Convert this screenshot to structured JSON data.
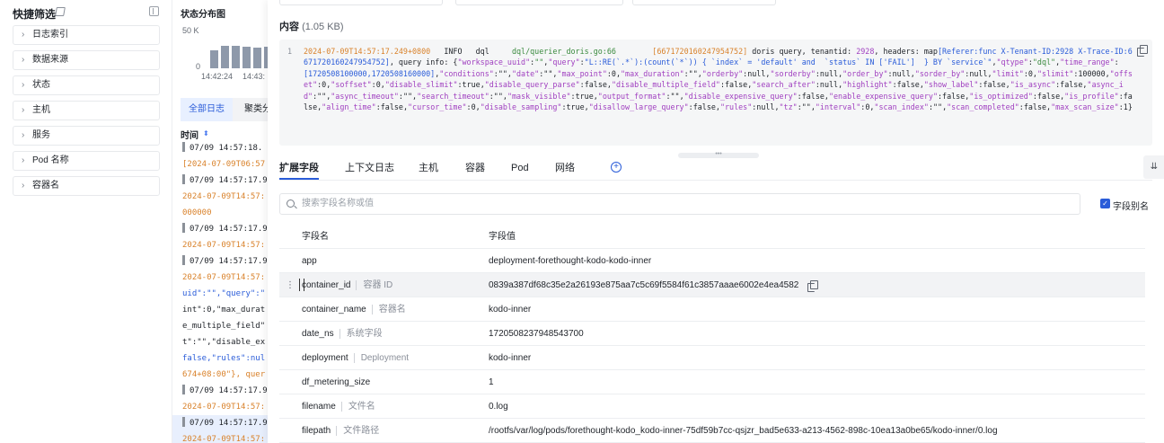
{
  "sidebar": {
    "title": "快捷筛选",
    "items": [
      "日志索引",
      "数据来源",
      "状态",
      "主机",
      "服务",
      "Pod 名称",
      "容器名"
    ]
  },
  "status_chart": {
    "title": "状态分布图",
    "y_max_label": "50 K",
    "y_min_label": "0",
    "x_labels": [
      "14:42:24",
      "14:43:"
    ]
  },
  "chart_data": {
    "type": "bar",
    "title": "状态分布图",
    "ylim": [
      0,
      50000
    ],
    "yticks": [
      "0",
      "50 K"
    ],
    "x_tick_labels": [
      "14:42:24",
      "14:43:"
    ],
    "values": [
      24000,
      30000,
      30000,
      29000,
      27000,
      28000
    ]
  },
  "mid_tabs": [
    "全部日志",
    "聚类分"
  ],
  "time_header": "时间",
  "log_rows": [
    {
      "t": "07/09 14:57:18.",
      "c": "ts"
    },
    {
      "t": "[2024-07-09T06:57",
      "c": "or"
    },
    {
      "t": "07/09 14:57:17.9",
      "c": "ts"
    },
    {
      "t": "2024-07-09T14:57:",
      "c": "or"
    },
    {
      "t": "000000",
      "c": "or"
    },
    {
      "t": "07/09 14:57:17.9",
      "c": "ts"
    },
    {
      "t": "2024-07-09T14:57:",
      "c": "or"
    },
    {
      "t": "07/09 14:57:17.9",
      "c": "ts"
    },
    {
      "t": "2024-07-09T14:57:",
      "c": "or"
    },
    {
      "t": "uid\":\"\",\"query\":\"",
      "c": "bl"
    },
    {
      "t": "int\":0,\"max_durat",
      "c": "ts2"
    },
    {
      "t": "e_multiple_field\"",
      "c": "ts2"
    },
    {
      "t": "t\":\"\",\"disable_ex",
      "c": "ts2"
    },
    {
      "t": "false,\"rules\":nul",
      "c": "bl"
    },
    {
      "t": "674+08:00\"}, quer",
      "c": "or"
    },
    {
      "t": "07/09 14:57:17.9",
      "c": "ts"
    },
    {
      "t": "2024-07-09T14:57:",
      "c": "or"
    },
    {
      "t": "07/09 14:57:17.9",
      "c": "ts hl"
    },
    {
      "t": "2024-07-09T14:57:",
      "c": "or hl"
    }
  ],
  "content": {
    "title": "内容",
    "size": "(1.05 KB)",
    "line_no": "1",
    "segments": [
      {
        "t": "2024-07-09T14:57:17.249+0800",
        "c": "c-or"
      },
      {
        "t": "   INFO   dql     ",
        "c": ""
      },
      {
        "t": "dql/querier_doris.go:66",
        "c": "c-gr"
      },
      {
        "t": "        ",
        "c": ""
      },
      {
        "t": "[6671720160247954752]",
        "c": "c-or"
      },
      {
        "t": " doris query, tenantid: ",
        "c": ""
      },
      {
        "t": "2928",
        "c": "c-pu"
      },
      {
        "t": ", headers: map",
        "c": ""
      },
      {
        "t": "[Referer:func X-Tenant-ID:2928 X-Trace-ID:6671720160247954752]",
        "c": "c-bl"
      },
      {
        "t": ", query info: {",
        "c": ""
      },
      {
        "t": "\"workspace_uuid\"",
        "c": "c-pu"
      },
      {
        "t": ":",
        "c": ""
      },
      {
        "t": "\"\"",
        "c": "c-gr"
      },
      {
        "t": ",",
        "c": ""
      },
      {
        "t": "\"query\"",
        "c": "c-pu"
      },
      {
        "t": ":",
        "c": ""
      },
      {
        "t": "\"L::RE(`.*`):(count(`*`)) { `index` = 'default' and  `status` IN ['FAIL']  } BY `service`\"",
        "c": "c-bl"
      },
      {
        "t": ",",
        "c": ""
      },
      {
        "t": "\"qtype\"",
        "c": "c-pu"
      },
      {
        "t": ":",
        "c": ""
      },
      {
        "t": "\"dql\"",
        "c": "c-gr"
      },
      {
        "t": ",",
        "c": ""
      },
      {
        "t": "\"time_range\"",
        "c": "c-pu"
      },
      {
        "t": ":\n",
        "c": ""
      },
      {
        "t": "[1720508100000,1720508160000]",
        "c": "c-bl"
      },
      {
        "t": ",",
        "c": ""
      },
      {
        "t": "\"conditions\"",
        "c": "c-pu"
      },
      {
        "t": ":\"\",",
        "c": ""
      },
      {
        "t": "\"date\"",
        "c": "c-pu"
      },
      {
        "t": ":\"\",",
        "c": ""
      },
      {
        "t": "\"max_point\"",
        "c": "c-pu"
      },
      {
        "t": ":0,",
        "c": ""
      },
      {
        "t": "\"max_duration\"",
        "c": "c-pu"
      },
      {
        "t": ":\"\",",
        "c": ""
      },
      {
        "t": "\"orderby\"",
        "c": "c-pu"
      },
      {
        "t": ":null,",
        "c": ""
      },
      {
        "t": "\"sorderby\"",
        "c": "c-pu"
      },
      {
        "t": ":null,",
        "c": ""
      },
      {
        "t": "\"order_by\"",
        "c": "c-pu"
      },
      {
        "t": ":null,",
        "c": ""
      },
      {
        "t": "\"sorder_by\"",
        "c": "c-pu"
      },
      {
        "t": ":null,",
        "c": ""
      },
      {
        "t": "\"limit\"",
        "c": "c-pu"
      },
      {
        "t": ":0,",
        "c": ""
      },
      {
        "t": "\"slimit\"",
        "c": "c-pu"
      },
      {
        "t": ":100000,",
        "c": ""
      },
      {
        "t": "\"offset\"",
        "c": "c-pu"
      },
      {
        "t": ":0,",
        "c": ""
      },
      {
        "t": "\"soffset\"",
        "c": "c-pu"
      },
      {
        "t": ":0,",
        "c": ""
      },
      {
        "t": "\"disable_slimit\"",
        "c": "c-pu"
      },
      {
        "t": ":true,",
        "c": ""
      },
      {
        "t": "\"disable_query_parse\"",
        "c": "c-pu"
      },
      {
        "t": ":false,",
        "c": ""
      },
      {
        "t": "\"disable_multiple_field\"",
        "c": "c-pu"
      },
      {
        "t": ":false,",
        "c": ""
      },
      {
        "t": "\"search_after\"",
        "c": "c-pu"
      },
      {
        "t": ":null,",
        "c": ""
      },
      {
        "t": "\"highlight\"",
        "c": "c-pu"
      },
      {
        "t": ":false,",
        "c": ""
      },
      {
        "t": "\"show_label\"",
        "c": "c-pu"
      },
      {
        "t": ":false,",
        "c": ""
      },
      {
        "t": "\"is_async\"",
        "c": "c-pu"
      },
      {
        "t": ":false,",
        "c": ""
      },
      {
        "t": "\"async_id\"",
        "c": "c-pu"
      },
      {
        "t": ":\"\",",
        "c": ""
      },
      {
        "t": "\"async_timeout\"",
        "c": "c-pu"
      },
      {
        "t": ":\"\",",
        "c": ""
      },
      {
        "t": "\"search_timeout\"",
        "c": "c-pu"
      },
      {
        "t": ":\"\",",
        "c": ""
      },
      {
        "t": "\"mask_visible\"",
        "c": "c-pu"
      },
      {
        "t": ":true,",
        "c": ""
      },
      {
        "t": "\"output_format\"",
        "c": "c-pu"
      },
      {
        "t": ":\"\",",
        "c": ""
      },
      {
        "t": "\"disable_expensive_query\"",
        "c": "c-pu"
      },
      {
        "t": ":false,",
        "c": ""
      },
      {
        "t": "\"enable_expensive_query\"",
        "c": "c-pu"
      },
      {
        "t": ":false,",
        "c": ""
      },
      {
        "t": "\"is_optimized\"",
        "c": "c-pu"
      },
      {
        "t": ":false,",
        "c": ""
      },
      {
        "t": "\"is_profile\"",
        "c": "c-pu"
      },
      {
        "t": ":false,",
        "c": ""
      },
      {
        "t": "\"align_time\"",
        "c": "c-pu"
      },
      {
        "t": ":false,",
        "c": ""
      },
      {
        "t": "\"cursor_time\"",
        "c": "c-pu"
      },
      {
        "t": ":0,",
        "c": ""
      },
      {
        "t": "\"disable_sampling\"",
        "c": "c-pu"
      },
      {
        "t": ":true,",
        "c": ""
      },
      {
        "t": "\"disallow_large_query\"",
        "c": "c-pu"
      },
      {
        "t": ":false,",
        "c": ""
      },
      {
        "t": "\"rules\"",
        "c": "c-pu"
      },
      {
        "t": ":null,",
        "c": ""
      },
      {
        "t": "\"tz\"",
        "c": "c-pu"
      },
      {
        "t": ":\"\",",
        "c": ""
      },
      {
        "t": "\"interval\"",
        "c": "c-pu"
      },
      {
        "t": ":0,",
        "c": ""
      },
      {
        "t": "\"scan_index\"",
        "c": "c-pu"
      },
      {
        "t": ":\"\",",
        "c": ""
      },
      {
        "t": "\"scan_completed\"",
        "c": "c-pu"
      },
      {
        "t": ":false,",
        "c": ""
      },
      {
        "t": "\"max_scan_size\"",
        "c": "c-pu"
      },
      {
        "t": ":1}",
        "c": ""
      }
    ]
  },
  "detail_tabs": [
    "扩展字段",
    "上下文日志",
    "主机",
    "容器",
    "Pod",
    "网络"
  ],
  "field_search": {
    "placeholder": "搜索字段名称或值"
  },
  "alias_toggle": {
    "label": "字段别名",
    "checked": true
  },
  "table": {
    "headers": [
      "字段名",
      "字段值"
    ],
    "rows": [
      {
        "name": "app",
        "alias": "",
        "value": "deployment-forethought-kodo-kodo-inner"
      },
      {
        "name": "container_id",
        "alias": "容器 ID",
        "value": "0839a387df68c35e2a26193e875aa7c5c69f5584f61c3857aaae6002e4ea4582"
      },
      {
        "name": "container_name",
        "alias": "容器名",
        "value": "kodo-inner"
      },
      {
        "name": "date_ns",
        "alias": "系统字段",
        "value": "1720508237948543700"
      },
      {
        "name": "deployment",
        "alias": "Deployment",
        "value": "kodo-inner"
      },
      {
        "name": "df_metering_size",
        "alias": "",
        "value": "1"
      },
      {
        "name": "filename",
        "alias": "文件名",
        "value": "0.log"
      },
      {
        "name": "filepath",
        "alias": "文件路径",
        "value": "/rootfs/var/log/pods/forethought-kodo_kodo-inner-75df59b7cc-qsjzr_bad5e633-a213-4562-898c-10ea13a0be65/kodo-inner/0.log"
      }
    ]
  },
  "colors": {
    "accent": "#2a5cd9",
    "bar": "#8e99aa",
    "orange": "#d9822b"
  }
}
